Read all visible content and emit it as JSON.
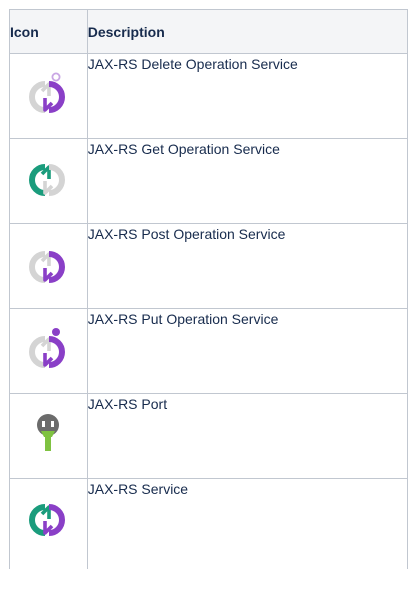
{
  "table": {
    "headers": {
      "icon": "Icon",
      "description": "Description"
    },
    "rows": [
      {
        "icon": "jaxrs-delete-operation-service-icon",
        "description": "JAX-RS Delete Operation Service"
      },
      {
        "icon": "jaxrs-get-operation-service-icon",
        "description": "JAX-RS Get Operation Service"
      },
      {
        "icon": "jaxrs-post-operation-service-icon",
        "description": "JAX-RS Post Operation Service"
      },
      {
        "icon": "jaxrs-put-operation-service-icon",
        "description": "JAX-RS Put Operation Service"
      },
      {
        "icon": "jaxrs-port-icon",
        "description": "JAX-RS Port"
      },
      {
        "icon": "jaxrs-service-icon",
        "description": "JAX-RS Service"
      }
    ]
  },
  "colors": {
    "header_bg": "#f4f5f7",
    "border": "#c1c7d0",
    "text": "#172b4d",
    "green": "#1a9c7c",
    "purple": "#8a3fc7",
    "gray": "#d4d4d4",
    "port_body": "#6b6b6b",
    "port_pin": "#7fc241"
  }
}
